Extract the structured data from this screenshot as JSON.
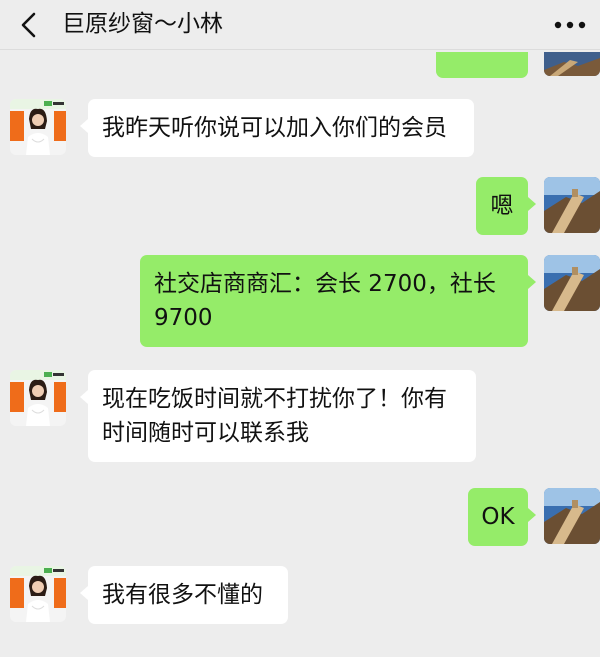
{
  "header": {
    "title": "巨原纱窗～小林",
    "back_icon": "chevron-left-icon",
    "more_icon": "more-dots-icon"
  },
  "messages": [
    {
      "side": "left",
      "text": "我昨天听你说可以加入你们的会员"
    },
    {
      "side": "right",
      "text": "嗯"
    },
    {
      "side": "right",
      "text": "社交店商商汇：会长 2700，社长 9700"
    },
    {
      "side": "left",
      "text": "现在吃饭时间就不打扰你了！你有时间随时可以联系我"
    },
    {
      "side": "right",
      "text": "OK"
    },
    {
      "side": "left",
      "text": "我有很多不懂的"
    }
  ],
  "colors": {
    "background": "#ededed",
    "sent_bubble": "#95ec69",
    "received_bubble": "#ffffff"
  }
}
